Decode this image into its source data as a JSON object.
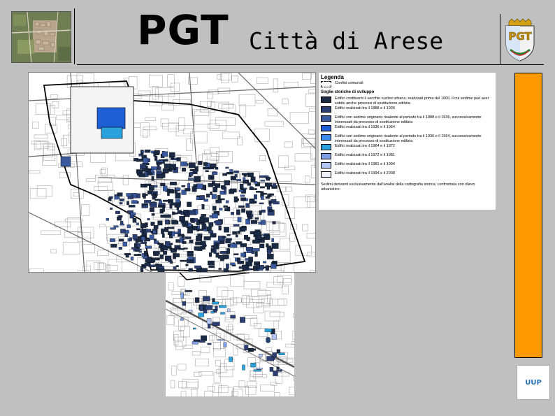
{
  "header": {
    "acronym": "PGT",
    "city": "Città di Arese"
  },
  "crest": {
    "letters": "PGT"
  },
  "legend": {
    "title": "Legenda",
    "boundary": {
      "label": "Confini comunali"
    },
    "section_title": "Soglie storiche di sviluppo",
    "items": [
      {
        "label": "Edifici costituenti il vecchio nucleo urbano, realizzati prima del 1000, il cui sedime può aver subito anche processi di sostituzione edilizia",
        "color": "#1b2a44"
      },
      {
        "label": "Edifici realizzati tra il 1888 e il 1936",
        "color": "#2b3f73"
      },
      {
        "label": "Edifici con sedime originario risalente al periodo tra il 1888 e il 1936, successivamente interessati da processo di sostituzione edilizia",
        "color": "#3a5aa0"
      },
      {
        "label": "Edifici realizzati tra il 1936 e il 1964",
        "color": "#1f5fd6"
      },
      {
        "label": "Edifici con sedime originario risalente al periodo tra il 1936 e il 1964, successivamente interessati da processo di sostituzione edilizia",
        "color": "#3b8cf0"
      },
      {
        "label": "Edifici realizzati tra il 1964 e il 1972",
        "color": "#2aa0dc"
      },
      {
        "label": "Edifici realizzati tra il 1972 e il 1981",
        "color": "#7e9ee6"
      },
      {
        "label": "Edifici realizzati tra il 1981 e il 1994",
        "color": "#b3c5f2"
      },
      {
        "label": "Edifici realizzati tra il 1994 e il 2008",
        "color": "#eef2fb"
      }
    ],
    "note": "Sedimi derivanti esclusivamente dall'analisi della cartografia storica, confrontata con rilievo urbanistico."
  },
  "logo": {
    "text": "UUP"
  },
  "colors": {
    "background": "#c0c0c0",
    "accent_bar": "#ff9900"
  }
}
